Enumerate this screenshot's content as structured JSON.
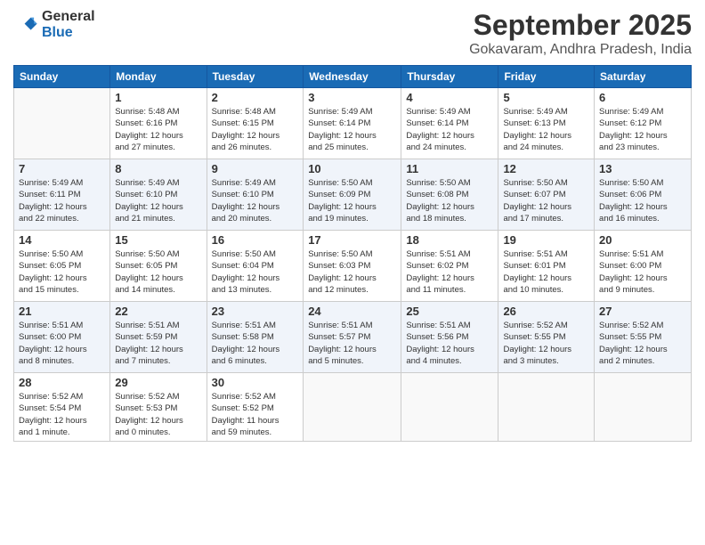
{
  "logo": {
    "line1": "General",
    "line2": "Blue"
  },
  "title": "September 2025",
  "location": "Gokavaram, Andhra Pradesh, India",
  "headers": [
    "Sunday",
    "Monday",
    "Tuesday",
    "Wednesday",
    "Thursday",
    "Friday",
    "Saturday"
  ],
  "weeks": [
    [
      {
        "num": "",
        "detail": ""
      },
      {
        "num": "1",
        "detail": "Sunrise: 5:48 AM\nSunset: 6:16 PM\nDaylight: 12 hours\nand 27 minutes."
      },
      {
        "num": "2",
        "detail": "Sunrise: 5:48 AM\nSunset: 6:15 PM\nDaylight: 12 hours\nand 26 minutes."
      },
      {
        "num": "3",
        "detail": "Sunrise: 5:49 AM\nSunset: 6:14 PM\nDaylight: 12 hours\nand 25 minutes."
      },
      {
        "num": "4",
        "detail": "Sunrise: 5:49 AM\nSunset: 6:14 PM\nDaylight: 12 hours\nand 24 minutes."
      },
      {
        "num": "5",
        "detail": "Sunrise: 5:49 AM\nSunset: 6:13 PM\nDaylight: 12 hours\nand 24 minutes."
      },
      {
        "num": "6",
        "detail": "Sunrise: 5:49 AM\nSunset: 6:12 PM\nDaylight: 12 hours\nand 23 minutes."
      }
    ],
    [
      {
        "num": "7",
        "detail": "Sunrise: 5:49 AM\nSunset: 6:11 PM\nDaylight: 12 hours\nand 22 minutes."
      },
      {
        "num": "8",
        "detail": "Sunrise: 5:49 AM\nSunset: 6:10 PM\nDaylight: 12 hours\nand 21 minutes."
      },
      {
        "num": "9",
        "detail": "Sunrise: 5:49 AM\nSunset: 6:10 PM\nDaylight: 12 hours\nand 20 minutes."
      },
      {
        "num": "10",
        "detail": "Sunrise: 5:50 AM\nSunset: 6:09 PM\nDaylight: 12 hours\nand 19 minutes."
      },
      {
        "num": "11",
        "detail": "Sunrise: 5:50 AM\nSunset: 6:08 PM\nDaylight: 12 hours\nand 18 minutes."
      },
      {
        "num": "12",
        "detail": "Sunrise: 5:50 AM\nSunset: 6:07 PM\nDaylight: 12 hours\nand 17 minutes."
      },
      {
        "num": "13",
        "detail": "Sunrise: 5:50 AM\nSunset: 6:06 PM\nDaylight: 12 hours\nand 16 minutes."
      }
    ],
    [
      {
        "num": "14",
        "detail": "Sunrise: 5:50 AM\nSunset: 6:05 PM\nDaylight: 12 hours\nand 15 minutes."
      },
      {
        "num": "15",
        "detail": "Sunrise: 5:50 AM\nSunset: 6:05 PM\nDaylight: 12 hours\nand 14 minutes."
      },
      {
        "num": "16",
        "detail": "Sunrise: 5:50 AM\nSunset: 6:04 PM\nDaylight: 12 hours\nand 13 minutes."
      },
      {
        "num": "17",
        "detail": "Sunrise: 5:50 AM\nSunset: 6:03 PM\nDaylight: 12 hours\nand 12 minutes."
      },
      {
        "num": "18",
        "detail": "Sunrise: 5:51 AM\nSunset: 6:02 PM\nDaylight: 12 hours\nand 11 minutes."
      },
      {
        "num": "19",
        "detail": "Sunrise: 5:51 AM\nSunset: 6:01 PM\nDaylight: 12 hours\nand 10 minutes."
      },
      {
        "num": "20",
        "detail": "Sunrise: 5:51 AM\nSunset: 6:00 PM\nDaylight: 12 hours\nand 9 minutes."
      }
    ],
    [
      {
        "num": "21",
        "detail": "Sunrise: 5:51 AM\nSunset: 6:00 PM\nDaylight: 12 hours\nand 8 minutes."
      },
      {
        "num": "22",
        "detail": "Sunrise: 5:51 AM\nSunset: 5:59 PM\nDaylight: 12 hours\nand 7 minutes."
      },
      {
        "num": "23",
        "detail": "Sunrise: 5:51 AM\nSunset: 5:58 PM\nDaylight: 12 hours\nand 6 minutes."
      },
      {
        "num": "24",
        "detail": "Sunrise: 5:51 AM\nSunset: 5:57 PM\nDaylight: 12 hours\nand 5 minutes."
      },
      {
        "num": "25",
        "detail": "Sunrise: 5:51 AM\nSunset: 5:56 PM\nDaylight: 12 hours\nand 4 minutes."
      },
      {
        "num": "26",
        "detail": "Sunrise: 5:52 AM\nSunset: 5:55 PM\nDaylight: 12 hours\nand 3 minutes."
      },
      {
        "num": "27",
        "detail": "Sunrise: 5:52 AM\nSunset: 5:55 PM\nDaylight: 12 hours\nand 2 minutes."
      }
    ],
    [
      {
        "num": "28",
        "detail": "Sunrise: 5:52 AM\nSunset: 5:54 PM\nDaylight: 12 hours\nand 1 minute."
      },
      {
        "num": "29",
        "detail": "Sunrise: 5:52 AM\nSunset: 5:53 PM\nDaylight: 12 hours\nand 0 minutes."
      },
      {
        "num": "30",
        "detail": "Sunrise: 5:52 AM\nSunset: 5:52 PM\nDaylight: 11 hours\nand 59 minutes."
      },
      {
        "num": "",
        "detail": ""
      },
      {
        "num": "",
        "detail": ""
      },
      {
        "num": "",
        "detail": ""
      },
      {
        "num": "",
        "detail": ""
      }
    ]
  ]
}
